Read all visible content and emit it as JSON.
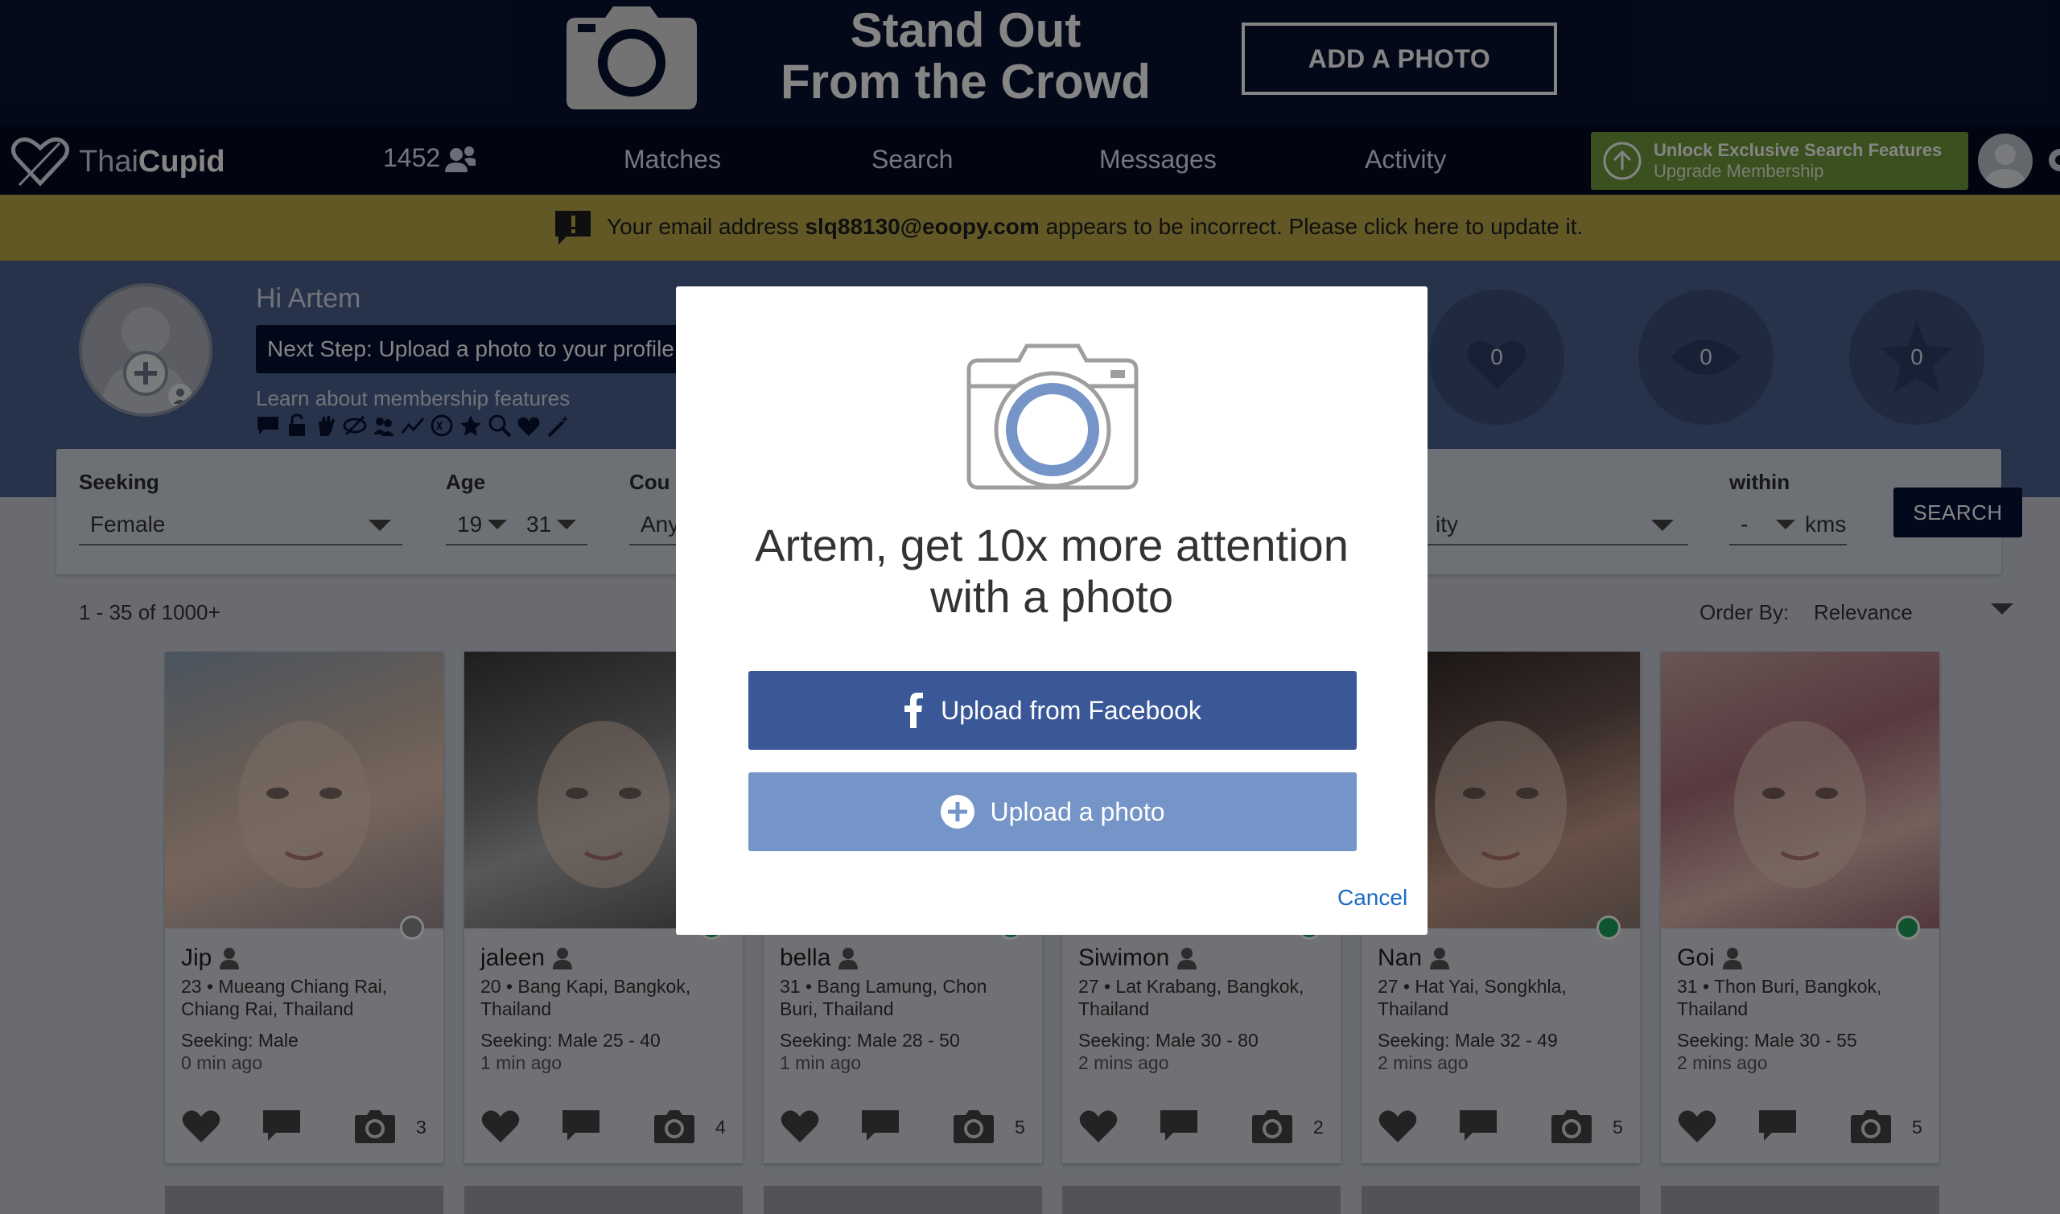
{
  "banner": {
    "title_line1": "Stand Out",
    "title_line2": "From the Crowd",
    "add_photo_label": "ADD A PHOTO"
  },
  "nav": {
    "logo_part1": "Thai",
    "logo_part2": "Cupid",
    "count": "1452",
    "links": [
      "Matches",
      "Search",
      "Messages",
      "Activity"
    ],
    "upgrade_line1": "Unlock Exclusive Search Features",
    "upgrade_line2": "Upgrade Membership"
  },
  "alert": {
    "prefix": "Your email address ",
    "email": "slq88130@eoopy.com",
    "suffix": " appears to be incorrect. Please click here to update it."
  },
  "profile": {
    "greeting": "Hi Artem",
    "next_step": "Next Step: Upload a photo to your profile",
    "learn": "Learn about membership features",
    "stats": [
      "0",
      "0",
      "0"
    ]
  },
  "filters": {
    "seeking_label": "Seeking",
    "seeking_value": "Female",
    "age_label": "Age",
    "age_min": "19",
    "age_max": "31",
    "country_label": "Cou",
    "country_value": "Any",
    "city_value": "ity",
    "within_label": "within",
    "within_value": "-",
    "within_unit": "kms",
    "search_label": "SEARCH"
  },
  "results": {
    "count_text": "1 - 35 of 1000+",
    "order_label": "Order By:",
    "order_value": "Relevance"
  },
  "cards": [
    {
      "name": "Jip",
      "loc": "23 • Mueang Chiang Rai, Chiang Rai, Thailand",
      "seek": "Seeking: Male",
      "ago": "0 min ago",
      "photos": "3",
      "online": false
    },
    {
      "name": "jaleen",
      "loc": "20 • Bang Kapi, Bangkok, Thailand",
      "seek": "Seeking: Male 25 - 40",
      "ago": "1 min ago",
      "photos": "4",
      "online": true
    },
    {
      "name": "bella",
      "loc": "31 • Bang Lamung, Chon Buri, Thailand",
      "seek": "Seeking: Male 28 - 50",
      "ago": "1 min ago",
      "photos": "5",
      "online": true
    },
    {
      "name": "Siwimon",
      "loc": "27 • Lat Krabang, Bangkok, Thailand",
      "seek": "Seeking: Male 30 - 80",
      "ago": "2 mins ago",
      "photos": "2",
      "online": true
    },
    {
      "name": "Nan",
      "loc": "27 • Hat Yai, Songkhla, Thailand",
      "seek": "Seeking: Male 32 - 49",
      "ago": "2 mins ago",
      "photos": "5",
      "online": true
    },
    {
      "name": "Goi",
      "loc": "31 • Thon Buri, Bangkok, Thailand",
      "seek": "Seeking: Male 30 - 55",
      "ago": "2 mins ago",
      "photos": "5",
      "online": true
    }
  ],
  "modal": {
    "headline_line1": "Artem, get 10x more attention",
    "headline_line2": "with a photo",
    "facebook_label": "Upload from Facebook",
    "upload_label": "Upload a photo",
    "cancel_label": "Cancel"
  },
  "colors": {
    "banner_bg": "#081330",
    "nav_bg": "#050a22",
    "alert_bg": "#bca94a",
    "profile_bg": "#4b6291",
    "upgrade_green": "#6f9a3a",
    "facebook_blue": "#3a5898",
    "upload_blue": "#7595c8",
    "online_green": "#1aa15a",
    "link_blue": "#1b6cc4"
  }
}
